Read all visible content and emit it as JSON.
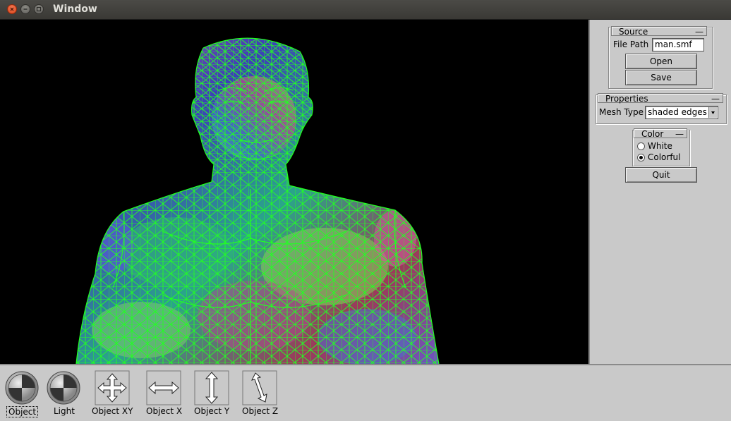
{
  "window": {
    "title": "Window"
  },
  "source": {
    "title": "Source",
    "file_path_label": "File Path",
    "file_path_value": "man.smf",
    "open_label": "Open",
    "save_label": "Save"
  },
  "properties": {
    "title": "Properties",
    "mesh_type_label": "Mesh Type",
    "mesh_type_value": "shaded edges"
  },
  "color": {
    "title": "Color",
    "options": [
      {
        "label": "White",
        "selected": false
      },
      {
        "label": "Colorful",
        "selected": true
      }
    ]
  },
  "quit_label": "Quit",
  "controls": [
    {
      "label": "Object",
      "icon": "rotation-ball-icon",
      "selected": true
    },
    {
      "label": "Light",
      "icon": "rotation-ball-icon",
      "selected": false
    },
    {
      "label": "Object XY",
      "icon": "move-xy-icon",
      "selected": false
    },
    {
      "label": "Object X",
      "icon": "move-x-icon",
      "selected": false
    },
    {
      "label": "Object Y",
      "icon": "move-y-icon",
      "selected": false
    },
    {
      "label": "Object Z",
      "icon": "move-z-icon",
      "selected": false
    }
  ],
  "colors": {
    "wireframe": "#00ff00",
    "background": "#000000",
    "panel": "#c9c9c9"
  }
}
